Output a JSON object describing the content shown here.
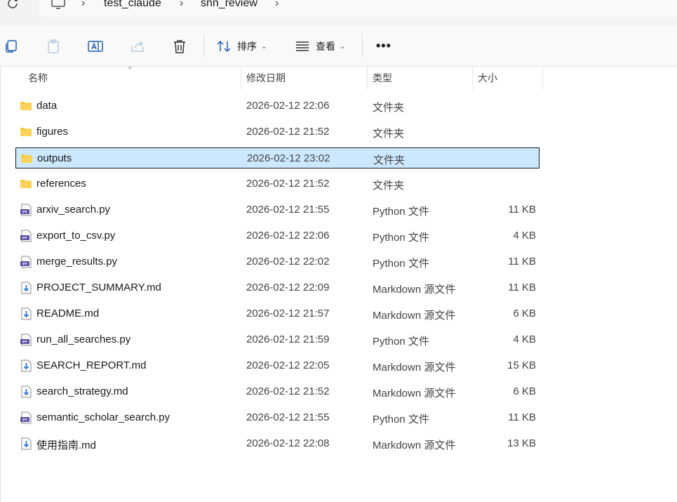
{
  "breadcrumb": {
    "items": [
      "test_claude",
      "snn_review"
    ]
  },
  "toolbar": {
    "sort_label": "排序",
    "view_label": "查看",
    "more_label": "•••"
  },
  "columns": {
    "name": "名称",
    "date": "修改日期",
    "type": "类型",
    "size": "大小"
  },
  "files": [
    {
      "name": "data",
      "date": "2026-02-12 22:06",
      "type": "文件夹",
      "size": "",
      "icon": "folder-icon",
      "selected": false
    },
    {
      "name": "figures",
      "date": "2026-02-12 21:52",
      "type": "文件夹",
      "size": "",
      "icon": "folder-icon",
      "selected": false
    },
    {
      "name": "outputs",
      "date": "2026-02-12 23:02",
      "type": "文件夹",
      "size": "",
      "icon": "folder-icon",
      "selected": true
    },
    {
      "name": "references",
      "date": "2026-02-12 21:52",
      "type": "文件夹",
      "size": "",
      "icon": "folder-icon",
      "selected": false
    },
    {
      "name": "arxiv_search.py",
      "date": "2026-02-12 21:55",
      "type": "Python 文件",
      "size": "11 KB",
      "icon": "python-file-icon",
      "selected": false
    },
    {
      "name": "export_to_csv.py",
      "date": "2026-02-12 22:06",
      "type": "Python 文件",
      "size": "4 KB",
      "icon": "python-file-icon",
      "selected": false
    },
    {
      "name": "merge_results.py",
      "date": "2026-02-12 22:02",
      "type": "Python 文件",
      "size": "11 KB",
      "icon": "python-file-icon",
      "selected": false
    },
    {
      "name": "PROJECT_SUMMARY.md",
      "date": "2026-02-12 22:09",
      "type": "Markdown 源文件",
      "size": "11 KB",
      "icon": "markdown-file-icon",
      "selected": false
    },
    {
      "name": "README.md",
      "date": "2026-02-12 21:57",
      "type": "Markdown 源文件",
      "size": "6 KB",
      "icon": "markdown-file-icon",
      "selected": false
    },
    {
      "name": "run_all_searches.py",
      "date": "2026-02-12 21:59",
      "type": "Python 文件",
      "size": "4 KB",
      "icon": "python-file-icon",
      "selected": false
    },
    {
      "name": "SEARCH_REPORT.md",
      "date": "2026-02-12 22:05",
      "type": "Markdown 源文件",
      "size": "15 KB",
      "icon": "markdown-file-icon",
      "selected": false
    },
    {
      "name": "search_strategy.md",
      "date": "2026-02-12 21:52",
      "type": "Markdown 源文件",
      "size": "6 KB",
      "icon": "markdown-file-icon",
      "selected": false
    },
    {
      "name": "semantic_scholar_search.py",
      "date": "2026-02-12 21:55",
      "type": "Python 文件",
      "size": "11 KB",
      "icon": "python-file-icon",
      "selected": false
    },
    {
      "name": "使用指南.md",
      "date": "2026-02-12 22:08",
      "type": "Markdown 源文件",
      "size": "13 KB",
      "icon": "markdown-file-icon",
      "selected": false
    }
  ],
  "colors": {
    "selection_bg": "#cce8ff",
    "folder": "#f8c936",
    "python_badge": "#5b4fa0",
    "markdown_arrow": "#2b7bd6"
  }
}
